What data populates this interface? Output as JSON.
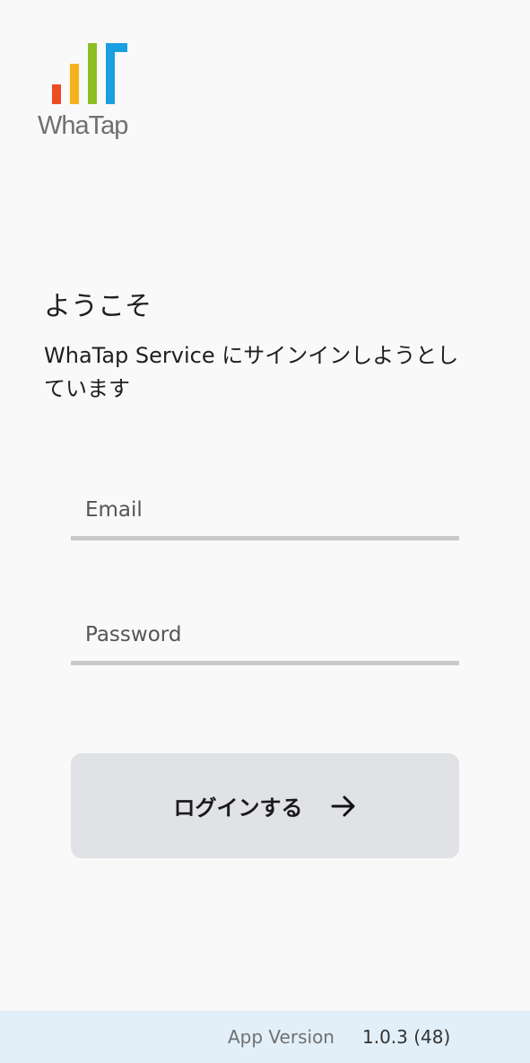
{
  "brand": {
    "name": "WhaTap",
    "colors": [
      "#ef4b23",
      "#f6b21b",
      "#8bbf24",
      "#1aa0e0"
    ],
    "word_color": "#707070"
  },
  "welcome": {
    "title": "ようこそ",
    "description": "WhaTap Service にサインインしようとしています"
  },
  "form": {
    "email_placeholder": "Email",
    "password_placeholder": "Password",
    "login_label": "ログインする",
    "login_icon": "arrow-right-icon",
    "button_bg": "#e0e2e6",
    "underline_color": "#c9c9c9"
  },
  "footer": {
    "version_label": "App Version",
    "version_value": "1.0.3 (48)",
    "bg": "#e2eff9"
  }
}
